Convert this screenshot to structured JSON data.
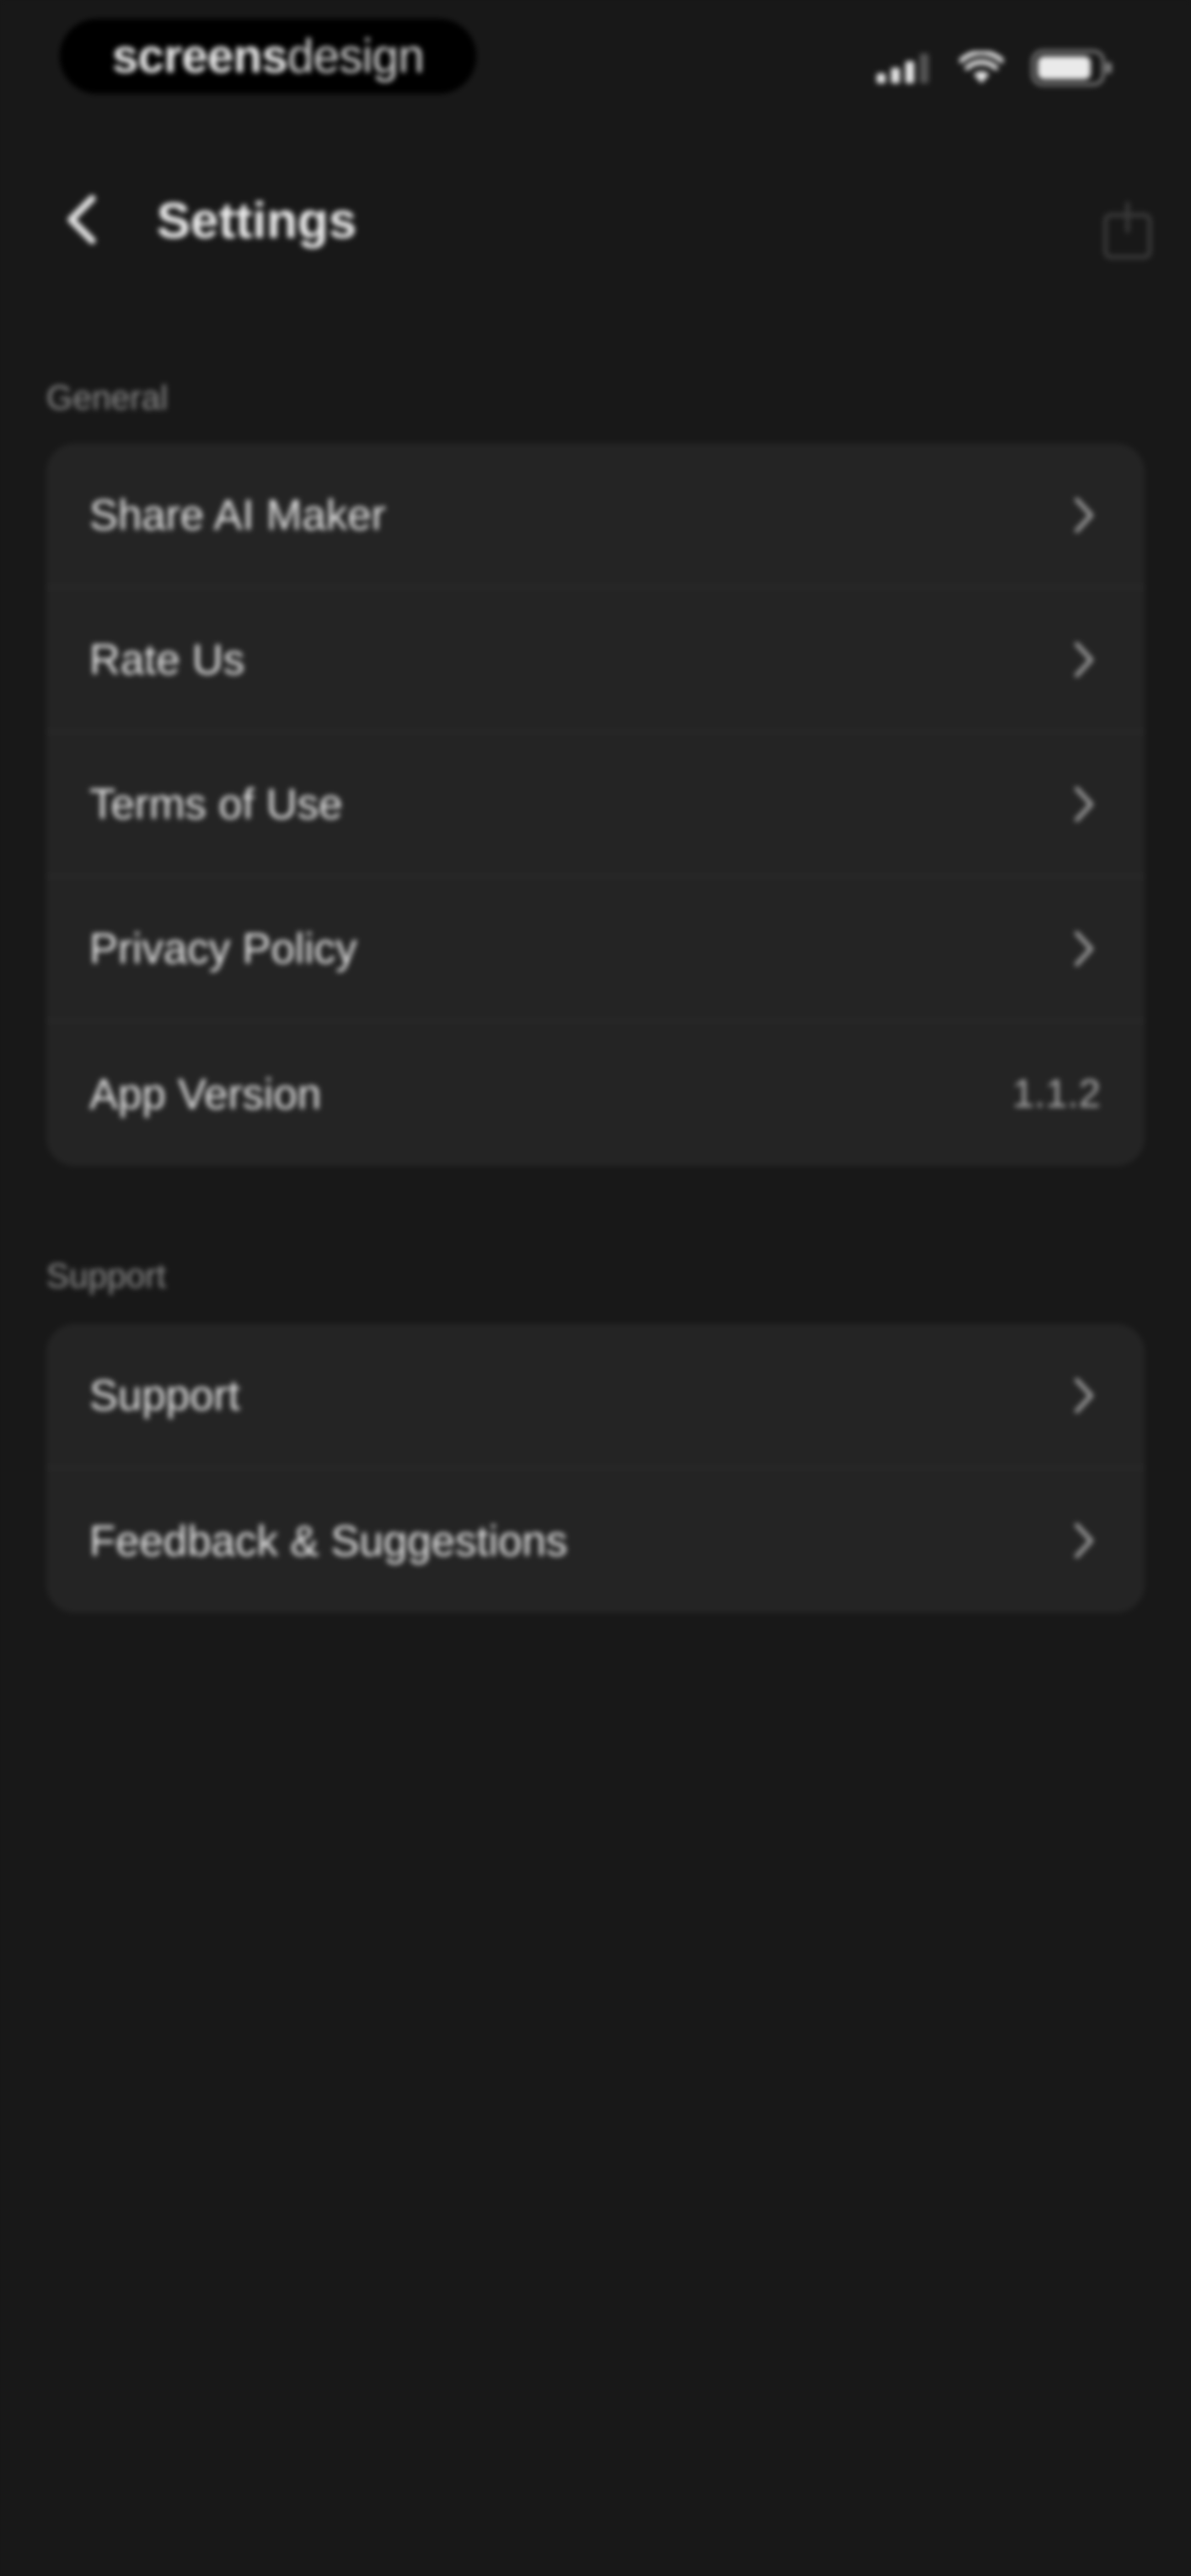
{
  "status_bar": {
    "brand_bold": "screens",
    "brand_light": "design"
  },
  "nav": {
    "title": "Settings"
  },
  "sections": [
    {
      "header": "General",
      "items": [
        {
          "label": "Share AI Maker"
        },
        {
          "label": "Rate Us"
        },
        {
          "label": "Terms of Use"
        },
        {
          "label": "Privacy Policy"
        },
        {
          "label": "App Version",
          "value": "1.1.2"
        }
      ]
    },
    {
      "header": "Support",
      "items": [
        {
          "label": "Support"
        },
        {
          "label": "Feedback & Suggestions"
        }
      ]
    }
  ],
  "icons": {
    "back": "chevron-left-icon",
    "row_disclosure": "chevron-right-icon",
    "signal": "cellular-signal-icon",
    "wifi": "wifi-icon",
    "battery": "battery-icon"
  },
  "colors": {
    "background": "#181818",
    "card": "#242424",
    "text_primary": "#e8e8e8",
    "text_secondary": "#8c8c8c"
  }
}
